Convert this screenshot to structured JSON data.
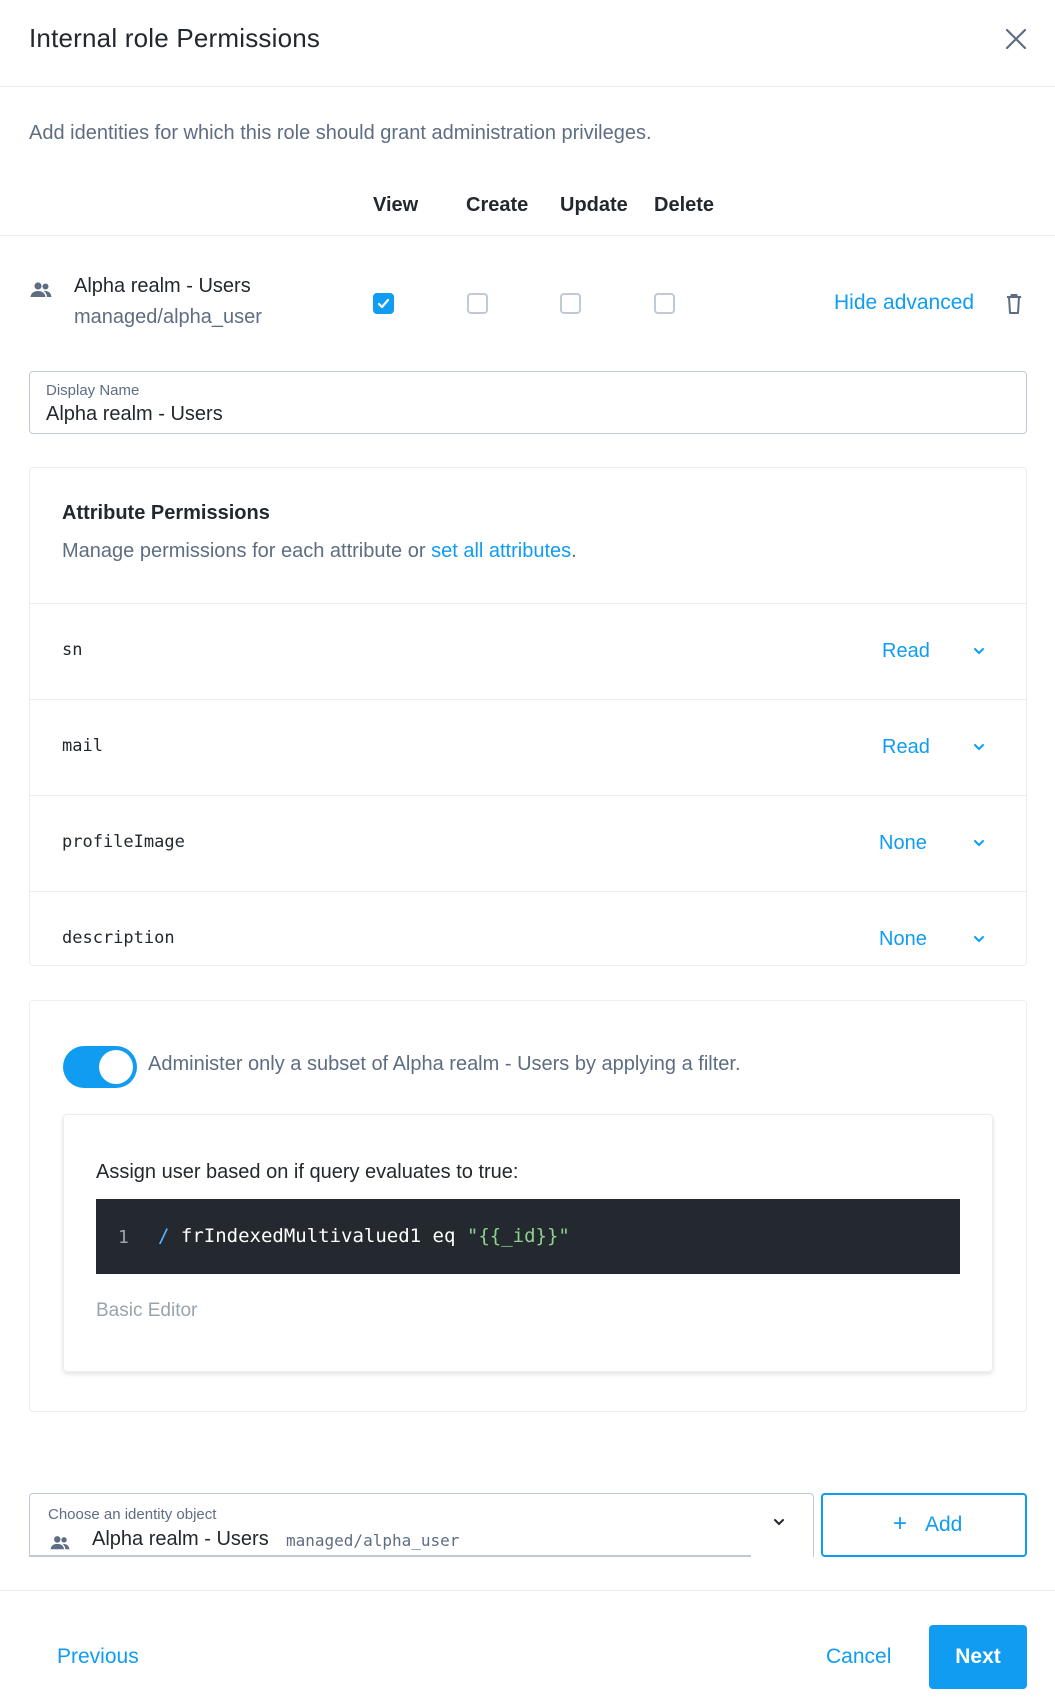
{
  "header": {
    "title": "Internal role Permissions",
    "close_icon": "close-icon"
  },
  "intro": "Add identities for which this role should grant administration privileges.",
  "columns": [
    "View",
    "Create",
    "Update",
    "Delete"
  ],
  "identity": {
    "icon": "users-icon",
    "name": "Alpha realm - Users",
    "path": "managed/alpha_user",
    "permissions": {
      "view": true,
      "create": false,
      "update": false,
      "delete": false
    },
    "hide_advanced": "Hide advanced",
    "delete_icon": "trash-icon"
  },
  "display_name": {
    "label": "Display Name",
    "value": "Alpha realm - Users"
  },
  "attributes": {
    "title": "Attribute Permissions",
    "desc_prefix": "Manage permissions for each attribute or ",
    "desc_link": "set all attributes",
    "desc_suffix": ".",
    "rows": [
      {
        "name": "sn",
        "value": "Read"
      },
      {
        "name": "mail",
        "value": "Read"
      },
      {
        "name": "profileImage",
        "value": "None"
      },
      {
        "name": "description",
        "value": "None"
      }
    ]
  },
  "filter": {
    "enabled": true,
    "label": "Administer only a subset of Alpha realm - Users by applying a filter.",
    "query_label": "Assign user based on if query evaluates to true:",
    "code_line_number": "1",
    "code_slash": "/",
    "code_expr": " frIndexedMultivalued1 eq ",
    "code_string": "\"{{_id}}\"",
    "basic_editor": "Basic Editor"
  },
  "choose_identity": {
    "label": "Choose an identity object",
    "icon": "users-icon",
    "name": "Alpha realm - Users",
    "path": "managed/alpha_user"
  },
  "add_button": {
    "plus": "+",
    "label": "Add"
  },
  "footer": {
    "previous": "Previous",
    "cancel": "Cancel",
    "next": "Next"
  },
  "colors": {
    "accent": "#109cf1",
    "code_bg": "#24292f"
  }
}
